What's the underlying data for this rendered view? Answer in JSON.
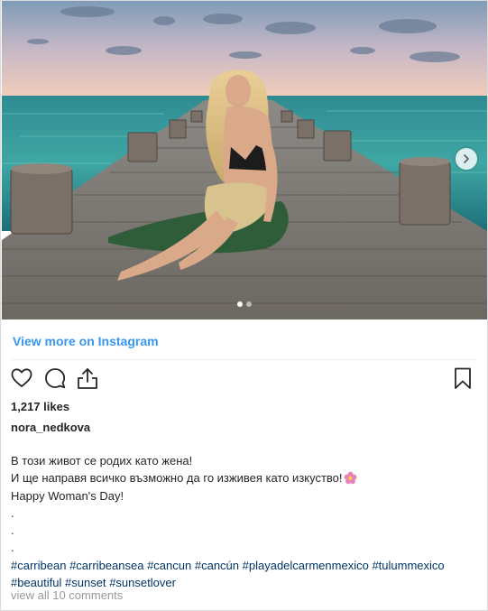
{
  "post": {
    "view_more_label": "View more on Instagram",
    "likes": "1,217 likes",
    "username": "nora_nedkova",
    "caption_lines": [
      "В този живот се родих като жена!",
      "И ще направя всичко възможно да го изживея като изкуство!",
      "Happy Woman's Day!",
      ".",
      ".",
      "."
    ],
    "hashtags_line1": [
      "#carribean",
      "#carribeansea",
      "#cancun",
      "#cancún",
      "#playadelcarmenmexico",
      "#tulummexico"
    ],
    "hashtags_line2": [
      "#beautiful",
      "#sunset",
      "#sunsetlover"
    ],
    "comments_label": "view all 10 comments",
    "carousel": {
      "slide_count": 2,
      "active_slide": 1
    }
  },
  "icons": {
    "like": "heart-icon",
    "comment": "comment-bubble-icon",
    "share": "share-icon",
    "save": "bookmark-icon",
    "next": "chevron-right-icon",
    "caption_emoji": "flower-emoji-icon"
  },
  "colors": {
    "link": "#3897f0",
    "hashtag": "#003569",
    "muted": "#999999",
    "text": "#262626"
  }
}
